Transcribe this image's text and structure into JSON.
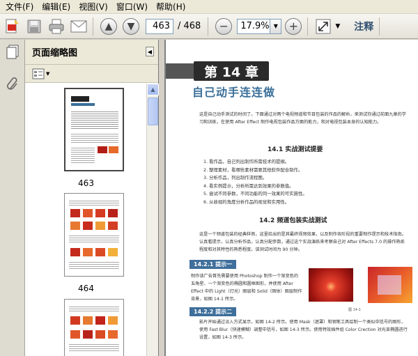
{
  "menu": {
    "items": [
      "文件(F)",
      "编辑(E)",
      "视图(V)",
      "窗口(W)",
      "帮助(H)"
    ]
  },
  "toolbar": {
    "current_page": "463",
    "total_pages": "/ 468",
    "zoom": "17.9%",
    "annotate_label": "注释"
  },
  "sidebar": {
    "title": "页面缩略图"
  },
  "thumbnails": [
    {
      "label": "463"
    },
    {
      "label": "464"
    }
  ],
  "document": {
    "chapter_tab": "第 14 章",
    "chapter_title": "自己动手连连做",
    "intro": "这是自己动手测试的时间了。下面通过对两个电视频道和节目包装的作品的解析，来测试你通过前面九章的学习和训练，在使用 After Effect 制作电视包装作品方面的能力，和对电视包装本身的认知能力。",
    "section1_heading": "14.1   实战测试提要",
    "list_items": [
      "1. 看作品，自己列出制作所需技术的提纲。",
      "2. 整理素材，看哪些素材需要其他软件配合制作。",
      "3. 分析作品，列出制作流程图。",
      "4. 看实例提示，分析所需达到效果的参数值。",
      "5. 尝试不同参数，不同功能的同一效果的可实施性。",
      "6. 从收视的角度分析作品的视觉和实用性。"
    ],
    "section2_heading": "14.2   频道包装实战测试",
    "para2": "这是一个频道包装的经典样例，这里给出的是其最终视频效果，以及制作各阶段的重要制作提示和技术指南。认真看提示，认真分析作品，认真分配参数，通过这个实战演练来考察自己对 After Effects 7.0 的操作熟练程度和对其特性的熟悉程度。该测试时间为 90 分钟。",
    "tip1_label": "14.2.1   提示一",
    "tip1_text": "制作该广告首先需要使用 Photoshop 制作一个渐变色的五角星、一个渐变色的椭圆和圆框图形，并使用 After Effect 中的 Light（灯光）图层和 Solid（固体）图层制作背景，如图 14-1 所示。",
    "fig_caption": "图 14-1",
    "tip2_label": "14.2.2   提示二",
    "tip2_text": "影片开始通过淡入方式显示，如图 14-2 所示。使用 Mask（遮罩）和钢笔工具绘制一个类似中括号的图形，使用 Fast Blur（快速模糊）调整中括号，如图 14-3 所示。使用特效插件组 Color Crection 对光束椭圆进行设置，如图 14-3 所示。"
  },
  "colors": {
    "accent_blue": "#3f6f9b",
    "chapter_dark": "#2b2b2b",
    "title_blue": "#3a6f9a"
  }
}
